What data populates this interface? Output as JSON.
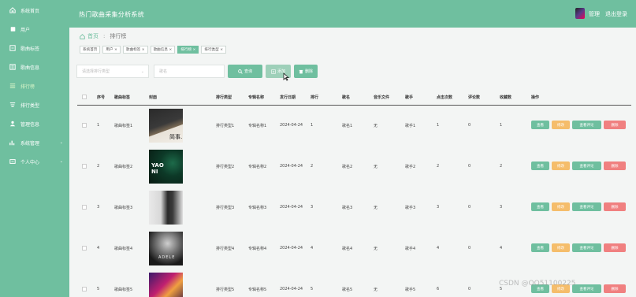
{
  "app": {
    "title": "热门歌曲采集分析系统"
  },
  "header": {
    "username": "管理",
    "logout": "退出登录"
  },
  "sidebar": {
    "items": [
      {
        "label": "系统首页",
        "icon": "home-icon"
      },
      {
        "label": "用户",
        "icon": "user-icon"
      },
      {
        "label": "歌曲标签",
        "icon": "tag-icon"
      },
      {
        "label": "歌曲信息",
        "icon": "music-icon"
      },
      {
        "label": "排行榜",
        "icon": "list-icon"
      },
      {
        "label": "排行类型",
        "icon": "filter-icon"
      },
      {
        "label": "管理信息",
        "icon": "person-icon"
      },
      {
        "label": "系统管理",
        "icon": "chart-icon"
      },
      {
        "label": "个人中心",
        "icon": "id-card-icon"
      }
    ]
  },
  "breadcrumb": {
    "home": "首页",
    "current": "排行榜"
  },
  "tags": [
    {
      "label": "系统首页",
      "closable": false
    },
    {
      "label": "用户 ×",
      "closable": true
    },
    {
      "label": "歌曲标签 ×",
      "closable": true
    },
    {
      "label": "歌曲信息 ×",
      "closable": true
    },
    {
      "label": "排行榜 ×",
      "closable": true
    },
    {
      "label": "排行类型 ×",
      "closable": true
    }
  ],
  "search": {
    "type_placeholder": "请选择排行类型",
    "keyword_placeholder": "歌名",
    "query_label": "查询",
    "add_label": "添加",
    "delete_label": "删除"
  },
  "table": {
    "headers": [
      "序号",
      "歌曲标签",
      "封面",
      "排行类型",
      "专辑名称",
      "发行日期",
      "排行",
      "歌名",
      "音乐文件",
      "歌手",
      "点击次数",
      "评论数",
      "收藏数",
      "操作"
    ],
    "rows": [
      {
        "no": "1",
        "tag": "歌曲标签1",
        "type": "排行类型1",
        "album": "专辑名称1",
        "date": "2024-04-24",
        "rank": "1",
        "name": "歌名1",
        "file": "无",
        "singer": "歌手1",
        "clicks": "1",
        "comments": "0",
        "favs": "1"
      },
      {
        "no": "2",
        "tag": "歌曲标签2",
        "type": "排行类型2",
        "album": "专辑名称2",
        "date": "2024-04-24",
        "rank": "2",
        "name": "歌名2",
        "file": "无",
        "singer": "歌手2",
        "clicks": "2",
        "comments": "0",
        "favs": "2"
      },
      {
        "no": "3",
        "tag": "歌曲标签3",
        "type": "排行类型3",
        "album": "专辑名称3",
        "date": "2024-04-24",
        "rank": "3",
        "name": "歌名3",
        "file": "无",
        "singer": "歌手3",
        "clicks": "3",
        "comments": "0",
        "favs": "3"
      },
      {
        "no": "4",
        "tag": "歌曲标签4",
        "type": "排行类型4",
        "album": "专辑名称4",
        "date": "2024-04-24",
        "rank": "4",
        "name": "歌名4",
        "file": "无",
        "singer": "歌手4",
        "clicks": "4",
        "comments": "0",
        "favs": "4"
      },
      {
        "no": "5",
        "tag": "歌曲标签5",
        "type": "排行类型5",
        "album": "专辑名称5",
        "date": "2024-04-24",
        "rank": "5",
        "name": "歌名5",
        "file": "无",
        "singer": "歌手5",
        "clicks": "6",
        "comments": "0",
        "favs": "5"
      }
    ],
    "op_labels": {
      "view": "查看",
      "edit": "修改",
      "comments": "查看评论",
      "delete": "删除"
    }
  },
  "watermark": "CSDN @QQ51100225",
  "colors": {
    "primary": "#6fbf9f",
    "warning": "#f5bd6b",
    "danger": "#f08080"
  }
}
